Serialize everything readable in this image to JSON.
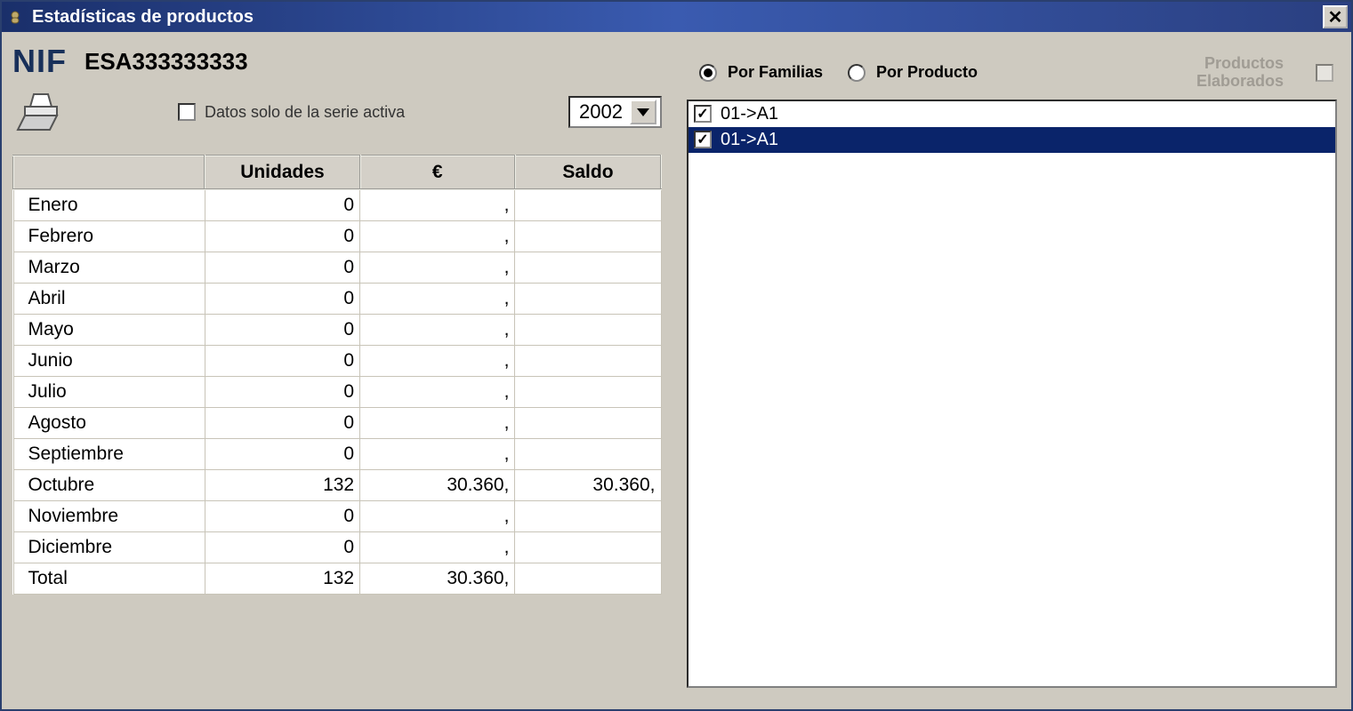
{
  "window": {
    "title": "Estadísticas de productos"
  },
  "nif": {
    "label": "NIF",
    "value": "ESA333333333"
  },
  "filters": {
    "active_series_label": "Datos solo de la serie activa",
    "year": "2002"
  },
  "table": {
    "headers": {
      "blank": "",
      "units": "Unidades",
      "euro": "€",
      "saldo": "Saldo"
    },
    "rows": [
      {
        "month": "Enero",
        "units": "0",
        "euro": ",",
        "saldo": ""
      },
      {
        "month": "Febrero",
        "units": "0",
        "euro": ",",
        "saldo": ""
      },
      {
        "month": "Marzo",
        "units": "0",
        "euro": ",",
        "saldo": ""
      },
      {
        "month": "Abril",
        "units": "0",
        "euro": ",",
        "saldo": ""
      },
      {
        "month": "Mayo",
        "units": "0",
        "euro": ",",
        "saldo": ""
      },
      {
        "month": "Junio",
        "units": "0",
        "euro": ",",
        "saldo": ""
      },
      {
        "month": "Julio",
        "units": "0",
        "euro": ",",
        "saldo": ""
      },
      {
        "month": "Agosto",
        "units": "0",
        "euro": ",",
        "saldo": ""
      },
      {
        "month": "Septiembre",
        "units": "0",
        "euro": ",",
        "saldo": ""
      },
      {
        "month": "Octubre",
        "units": "132",
        "euro": "30.360,",
        "saldo": "30.360,"
      },
      {
        "month": "Noviembre",
        "units": "0",
        "euro": ",",
        "saldo": ""
      },
      {
        "month": "Diciembre",
        "units": "0",
        "euro": ",",
        "saldo": ""
      },
      {
        "month": "Total",
        "units": "132",
        "euro": "30.360,",
        "saldo": ""
      }
    ]
  },
  "right": {
    "radio_familias": "Por Familias",
    "radio_producto": "Por Producto",
    "elaborados_line1": "Productos",
    "elaborados_line2": "Elaborados",
    "items": [
      {
        "label": "01->A1",
        "checked": true,
        "selected": false
      },
      {
        "label": "01->A1",
        "checked": true,
        "selected": true
      }
    ]
  }
}
